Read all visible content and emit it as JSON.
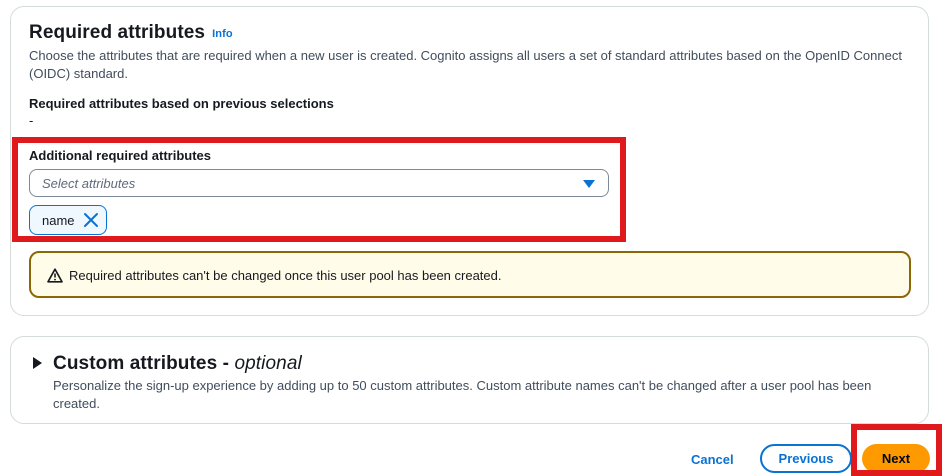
{
  "required_section": {
    "title": "Required attributes",
    "info": "Info",
    "description": "Choose the attributes that are required when a new user is created. Cognito assigns all users a set of standard attributes based on the OpenID Connect (OIDC) standard.",
    "previous_label": "Required attributes based on previous selections",
    "previous_value": "-",
    "additional_label": "Additional required attributes",
    "select_placeholder": "Select attributes",
    "tokens": [
      "name"
    ],
    "alert_text": "Required attributes can't be changed once this user pool has been created."
  },
  "custom_section": {
    "title": "Custom attributes - ",
    "title_optional": "optional",
    "description": "Personalize the sign-up experience by adding up to 50 custom attributes. Custom attribute names can't be changed after a user pool has been created."
  },
  "footer": {
    "cancel": "Cancel",
    "previous": "Previous",
    "next": "Next"
  },
  "colors": {
    "accent": "#0972d3",
    "primary_button": "#ff9900",
    "highlight": "#e0191d",
    "warning_border": "#8d6605",
    "warning_bg": "#fffce9"
  }
}
